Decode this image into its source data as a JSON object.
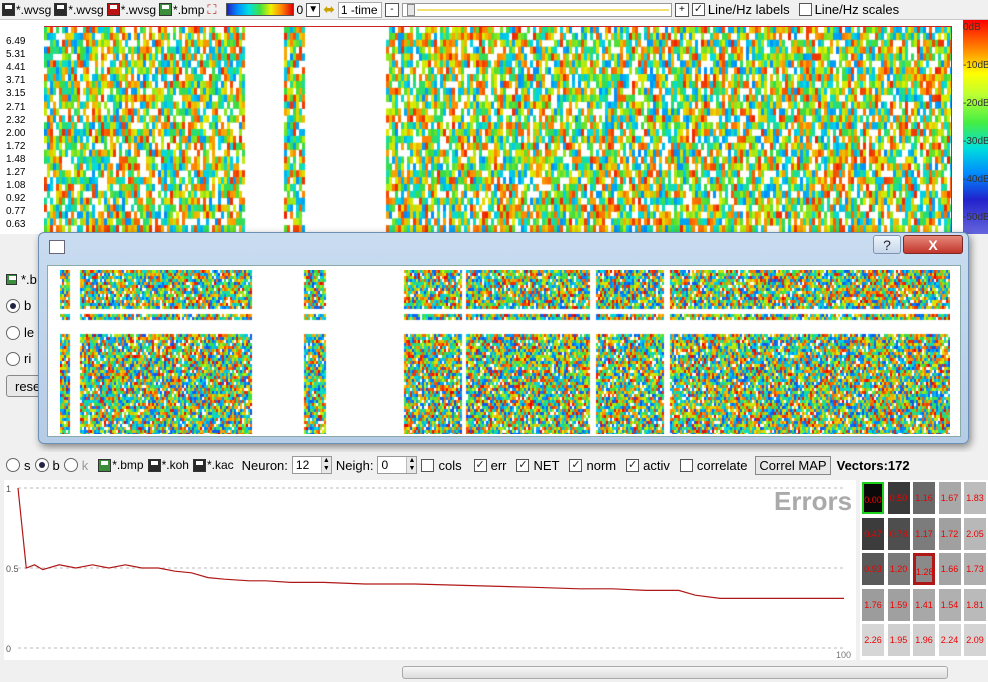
{
  "toolbar": {
    "items": [
      "*.wvsg",
      "*.wvsg",
      "*.wvsg",
      "*.bmp"
    ],
    "colorbar_value": "0",
    "time_value": "1 -time",
    "minus": "-",
    "plus": "+",
    "line_hz_labels": "Line/Hz labels",
    "line_hz_scales": "Line/Hz scales",
    "line_hz_labels_checked": true,
    "line_hz_scales_checked": false
  },
  "spectrogram": {
    "y_ticks": [
      "6.49",
      "5.31",
      "4.41",
      "3.71",
      "3.15",
      "2.71",
      "2.32",
      "2.00",
      "1.72",
      "1.48",
      "1.27",
      "1.08",
      "0.92",
      "0.77",
      "0.63"
    ],
    "db_ticks": [
      "0dB",
      "-10dB",
      "-20dB",
      "-30dB",
      "-40dB",
      "-50dB"
    ]
  },
  "side_panel": {
    "items": [
      {
        "label": "*.b",
        "type": "file"
      },
      {
        "label": "b",
        "type": "radio",
        "checked": true
      },
      {
        "label": "le",
        "type": "radio",
        "checked": false
      },
      {
        "label": "ri",
        "type": "radio",
        "checked": false
      }
    ],
    "reset_label": "rese"
  },
  "dialog": {
    "help": "?",
    "close": "X"
  },
  "controls": {
    "radio_s": "s",
    "radio_b": "b",
    "radio_k": "k",
    "save_bmp": "*.bmp",
    "save_koh": "*.koh",
    "save_kac": "*.kac",
    "neuron_label": "Neuron:",
    "neuron_value": "12",
    "neigh_label": "Neigh:",
    "neigh_value": "0",
    "cols": "cols",
    "err": "err",
    "net": "NET",
    "norm": "norm",
    "activ": "activ",
    "correlate": "correlate",
    "correl_map": "Correl MAP",
    "vectors": "Vectors:172",
    "checks": {
      "cols": false,
      "err": true,
      "net": true,
      "norm": true,
      "activ": true,
      "correlate": false
    }
  },
  "error_plot": {
    "title": "Errors",
    "y_labels": [
      "1",
      "0.5",
      "0"
    ],
    "x_label_end": "100"
  },
  "chart_data": {
    "type": "line",
    "title": "Errors",
    "xlim": [
      0,
      100
    ],
    "ylim": [
      0,
      1
    ],
    "series": [
      {
        "x": [
          0,
          1,
          2,
          3,
          5,
          7,
          9,
          11,
          13,
          15,
          17,
          19,
          21,
          23,
          25,
          28,
          30,
          33,
          37,
          42,
          48,
          55,
          62,
          68,
          72,
          76,
          80,
          82,
          85,
          88,
          92,
          96,
          100
        ],
        "y": [
          1.0,
          0.5,
          0.52,
          0.49,
          0.52,
          0.5,
          0.52,
          0.5,
          0.52,
          0.5,
          0.5,
          0.48,
          0.47,
          0.44,
          0.43,
          0.42,
          0.42,
          0.41,
          0.41,
          0.4,
          0.4,
          0.39,
          0.38,
          0.37,
          0.37,
          0.36,
          0.36,
          0.33,
          0.31,
          0.31,
          0.31,
          0.31,
          0.31
        ]
      }
    ]
  },
  "grid": {
    "values": [
      [
        "0.00",
        "0.50",
        "1.16",
        "1.67",
        "1.83"
      ],
      [
        "0.47",
        "0.78",
        "1.17",
        "1.72",
        "2.05"
      ],
      [
        "0.93",
        "1.20",
        "1.28",
        "1.66",
        "1.73"
      ],
      [
        "1.76",
        "1.59",
        "1.41",
        "1.54",
        "1.81"
      ],
      [
        "2.26",
        "1.95",
        "1.96",
        "2.24",
        "2.09"
      ]
    ],
    "shades": [
      [
        "#0a0a0a",
        "#3a3a3a",
        "#6a6a6a",
        "#a8a8a8",
        "#bcbcbc"
      ],
      [
        "#3c3c3c",
        "#4e4e4e",
        "#7c7c7c",
        "#a0a0a0",
        "#b8b8b8"
      ],
      [
        "#5a5a5a",
        "#7a7a7a",
        "#8a8a8a",
        "#a4a4a4",
        "#b0b0b0"
      ],
      [
        "#9c9c9c",
        "#a0a0a0",
        "#a8a8a8",
        "#b0b0b0",
        "#bababa"
      ],
      [
        "#d6d6d6",
        "#cfcfcf",
        "#d0d0d0",
        "#d8d8d8",
        "#d4d4d4"
      ]
    ]
  }
}
